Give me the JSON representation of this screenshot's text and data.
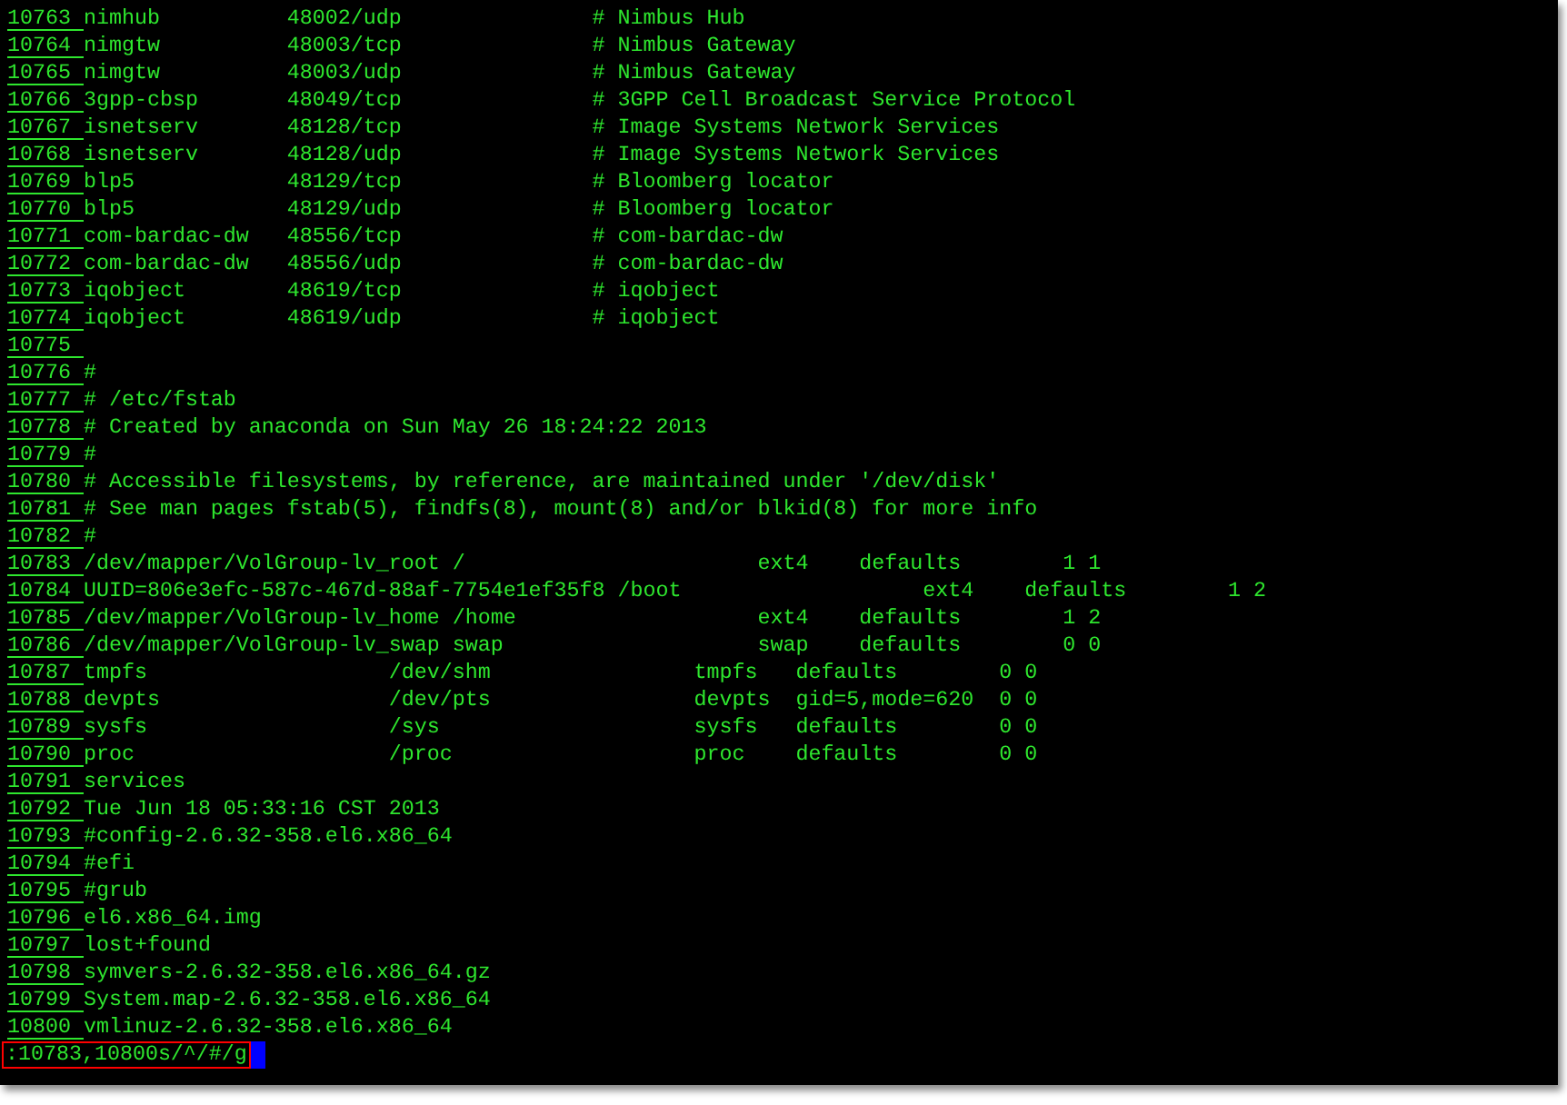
{
  "lines": [
    {
      "number": "10763",
      "text": "nimhub          48002/udp               # Nimbus Hub"
    },
    {
      "number": "10764",
      "text": "nimgtw          48003/tcp               # Nimbus Gateway"
    },
    {
      "number": "10765",
      "text": "nimgtw          48003/udp               # Nimbus Gateway"
    },
    {
      "number": "10766",
      "text": "3gpp-cbsp       48049/tcp               # 3GPP Cell Broadcast Service Protocol"
    },
    {
      "number": "10767",
      "text": "isnetserv       48128/tcp               # Image Systems Network Services"
    },
    {
      "number": "10768",
      "text": "isnetserv       48128/udp               # Image Systems Network Services"
    },
    {
      "number": "10769",
      "text": "blp5            48129/tcp               # Bloomberg locator"
    },
    {
      "number": "10770",
      "text": "blp5            48129/udp               # Bloomberg locator"
    },
    {
      "number": "10771",
      "text": "com-bardac-dw   48556/tcp               # com-bardac-dw"
    },
    {
      "number": "10772",
      "text": "com-bardac-dw   48556/udp               # com-bardac-dw"
    },
    {
      "number": "10773",
      "text": "iqobject        48619/tcp               # iqobject"
    },
    {
      "number": "10774",
      "text": "iqobject        48619/udp               # iqobject"
    },
    {
      "number": "10775"
    },
    {
      "number": "10776",
      "text": "#"
    },
    {
      "number": "10777",
      "text": "# /etc/fstab"
    },
    {
      "number": "10778",
      "text": "# Created by anaconda on Sun May 26 18:24:22 2013"
    },
    {
      "number": "10779",
      "text": "#"
    },
    {
      "number": "10780",
      "text": "# Accessible filesystems, by reference, are maintained under '/dev/disk'"
    },
    {
      "number": "10781",
      "text": "# See man pages fstab(5), findfs(8), mount(8) and/or blkid(8) for more info"
    },
    {
      "number": "10782",
      "text": "#"
    },
    {
      "number": "10783",
      "text": "/dev/mapper/VolGroup-lv_root /                       ext4    defaults        1 1"
    },
    {
      "number": "10784",
      "text": "UUID=806e3efc-587c-467d-88af-7754e1ef35f8 /boot                   ext4    defaults        1 2"
    },
    {
      "number": "10785",
      "text": "/dev/mapper/VolGroup-lv_home /home                   ext4    defaults        1 2"
    },
    {
      "number": "10786",
      "text": "/dev/mapper/VolGroup-lv_swap swap                    swap    defaults        0 0"
    },
    {
      "number": "10787",
      "text": "tmpfs                   /dev/shm                tmpfs   defaults        0 0"
    },
    {
      "number": "10788",
      "text": "devpts                  /dev/pts                devpts  gid=5,mode=620  0 0"
    },
    {
      "number": "10789",
      "text": "sysfs                   /sys                    sysfs   defaults        0 0"
    },
    {
      "number": "10790",
      "text": "proc                    /proc                   proc    defaults        0 0"
    },
    {
      "number": "10791",
      "text": "services"
    },
    {
      "number": "10792",
      "text": "Tue Jun 18 05:33:16 CST 2013"
    },
    {
      "number": "10793",
      "text": "#config-2.6.32-358.el6.x86_64"
    },
    {
      "number": "10794",
      "text": "#efi"
    },
    {
      "number": "10795",
      "text": "#grub"
    },
    {
      "number": "10796",
      "text": "el6.x86_64.img"
    },
    {
      "number": "10797",
      "text": "lost+found"
    },
    {
      "number": "10798",
      "text": "symvers-2.6.32-358.el6.x86_64.gz"
    },
    {
      "number": "10799",
      "text": "System.map-2.6.32-358.el6.x86_64"
    },
    {
      "number": "10800",
      "text": "vmlinuz-2.6.32-358.el6.x86_64"
    }
  ],
  "command": {
    "text": ":10783,10800s/^/#/g"
  }
}
